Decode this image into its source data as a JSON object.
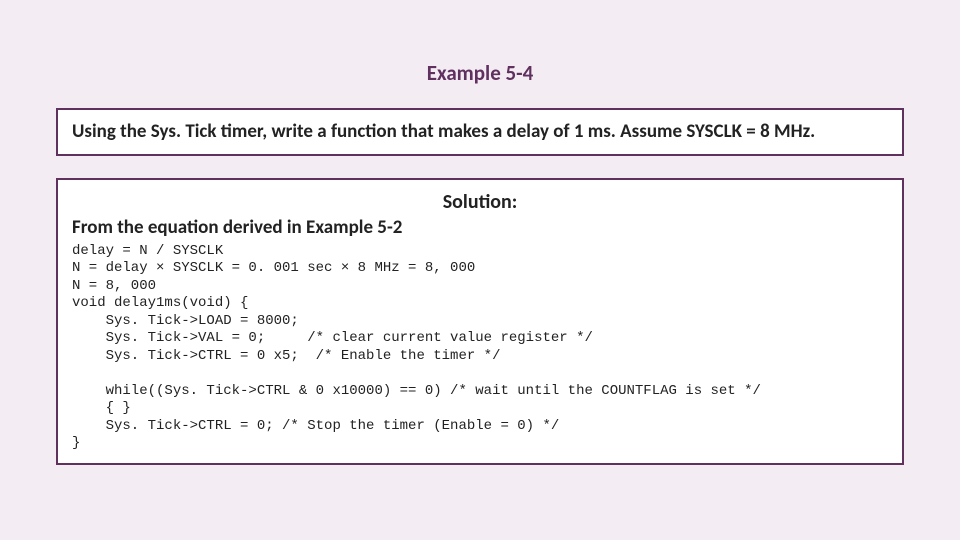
{
  "title": "Example 5-4",
  "prompt": "Using the Sys. Tick timer, write a function that makes a delay of 1 ms. Assume SYSCLK = 8 MHz.",
  "solution_label": "Solution:",
  "equation_ref": "From the equation derived in Example 5-2",
  "code": "delay = N / SYSCLK\nN = delay × SYSCLK = 0. 001 sec × 8 MHz = 8, 000\nN = 8, 000\nvoid delay1ms(void) {\n    Sys. Tick->LOAD = 8000;\n    Sys. Tick->VAL = 0;     /* clear current value register */\n    Sys. Tick->CTRL = 0 x5;  /* Enable the timer */\n\n    while((Sys. Tick->CTRL & 0 x10000) == 0) /* wait until the COUNTFLAG is set */\n    { }\n    Sys. Tick->CTRL = 0; /* Stop the timer (Enable = 0) */\n}"
}
